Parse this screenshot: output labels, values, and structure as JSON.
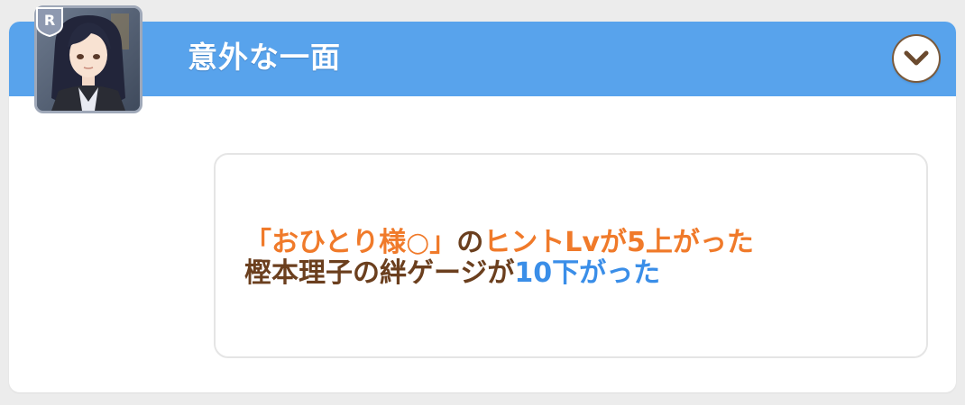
{
  "header": {
    "title": "意外な一面",
    "expand_icon": "chevron-down-icon",
    "color": "#58a3ec"
  },
  "portrait": {
    "rarity": "R"
  },
  "result": {
    "line1": {
      "skill_name": "「おひとり様○」",
      "particle": "の",
      "effect": "ヒントLvが5上がった"
    },
    "line2": {
      "character": "樫本理子の絆ゲージが",
      "amount": "10下がった"
    }
  },
  "colors": {
    "accent_orange": "#f07a2a",
    "accent_blue": "#3a8ee8",
    "text_brown": "#6b3f1e"
  }
}
